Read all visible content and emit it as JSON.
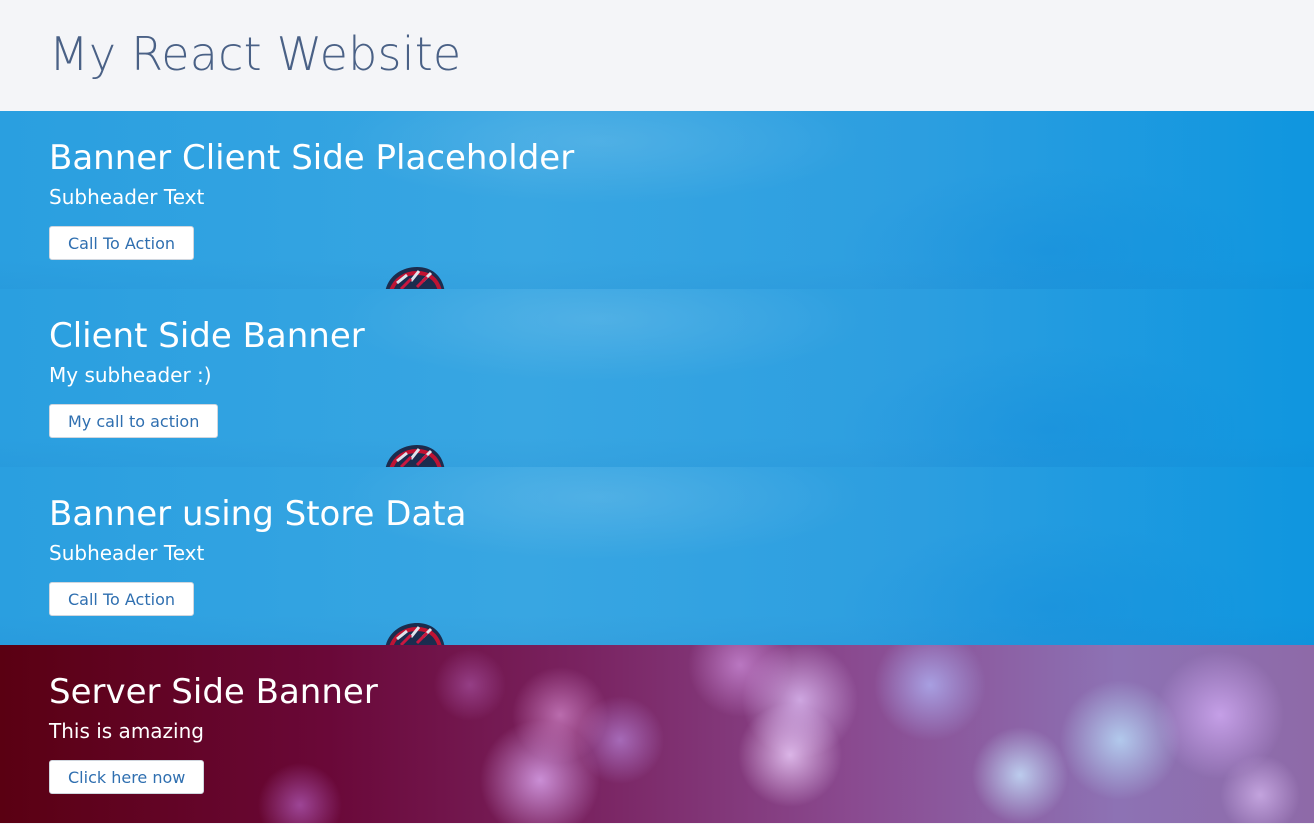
{
  "header": {
    "title": "My React Website"
  },
  "banners": [
    {
      "title": "Banner Client Side Placeholder",
      "subtitle": "Subheader Text",
      "cta": "Call To Action",
      "background": "sky-with-helmet"
    },
    {
      "title": "Client Side Banner",
      "subtitle": "My subheader :)",
      "cta": "My call to action",
      "background": "sky-with-helmet"
    },
    {
      "title": "Banner using Store Data",
      "subtitle": "Subheader Text",
      "cta": "Call To Action",
      "background": "sky-with-helmet"
    },
    {
      "title": "Server Side Banner",
      "subtitle": "This is amazing",
      "cta": "Click here now",
      "background": "purple-bokeh"
    }
  ],
  "colors": {
    "header_bg": "#f4f5f8",
    "title_text": "#4a6186",
    "sky_blue": "#2a9fe0",
    "bokeh_dark": "#5a0012",
    "bokeh_light": "#8e6aa8",
    "button_text": "#2f6fb0"
  },
  "icons": [
    "bicycle-helmet-icon"
  ]
}
